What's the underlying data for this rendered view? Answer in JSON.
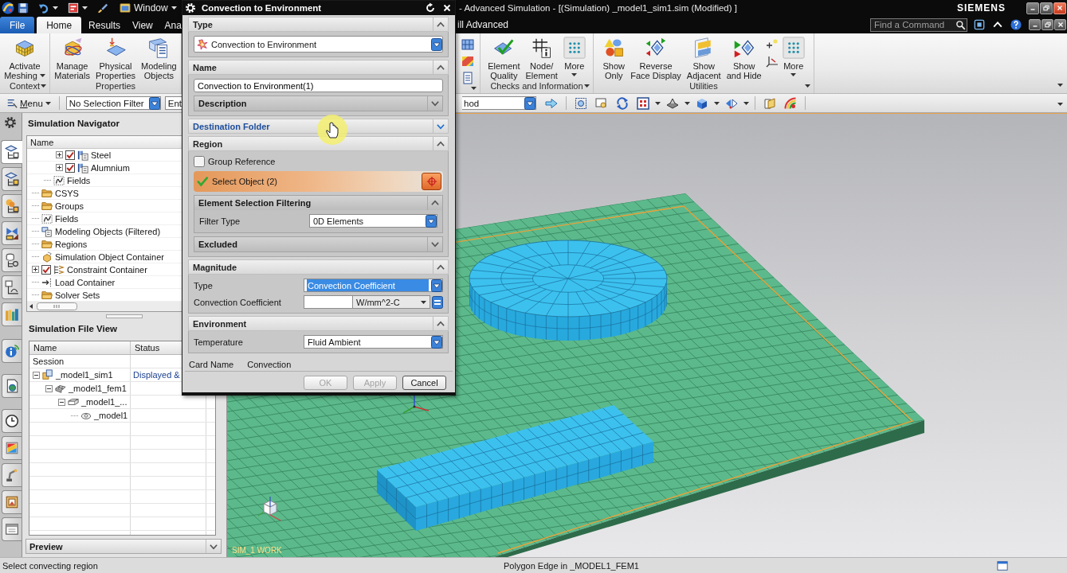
{
  "title_bar": {
    "menu": "Window",
    "title": "- Advanced Simulation - [(Simulation) _model1_sim1.sim (Modified) ]",
    "brand": "SIEMENS"
  },
  "tab_bar": {
    "tabs": [
      {
        "label": "File",
        "kind": "file",
        "selected": false
      },
      {
        "label": "Home",
        "kind": "tab",
        "selected": true
      },
      {
        "label": "Results",
        "kind": "tab",
        "selected": false
      },
      {
        "label": "View",
        "kind": "tab",
        "selected": false
      },
      {
        "label": "Ana",
        "kind": "tab",
        "selected": false
      }
    ],
    "application": "ill Advanced",
    "command_finder": {
      "placeholder": "Find a Command"
    }
  },
  "ribbon_groups": [
    {
      "label": "Context",
      "launcher": true,
      "commands": [
        {
          "kind": "large",
          "lines": [
            "Activate",
            "Meshing"
          ],
          "dropdown": true
        }
      ]
    },
    {
      "label": "Properties",
      "launcher": false,
      "commands": [
        {
          "kind": "large",
          "lines": [
            "Manage",
            "Materials"
          ],
          "dropdown": false
        },
        {
          "kind": "large",
          "lines": [
            "Physical",
            "Properties"
          ],
          "dropdown": false
        },
        {
          "kind": "large",
          "lines": [
            "Modeling",
            "Objects"
          ],
          "dropdown": false
        }
      ]
    },
    {
      "launcher": true,
      "commands": [
        {
          "kind": "small"
        },
        {
          "kind": "small"
        },
        {
          "kind": "small"
        }
      ]
    },
    {
      "label": "Checks and Information",
      "launcher": true,
      "commands": [
        {
          "kind": "large",
          "lines": [
            "Element",
            "Quality"
          ],
          "dropdown": false
        },
        {
          "kind": "large",
          "lines": [
            "Node/",
            "Element"
          ],
          "dropdown": false
        },
        {
          "kind": "large",
          "lines": [
            "More"
          ],
          "dropdown": true
        }
      ]
    },
    {
      "label": "Utilities",
      "launcher": true,
      "commands": [
        {
          "kind": "large",
          "lines": [
            "Show",
            "Only"
          ],
          "dropdown": false
        },
        {
          "kind": "large",
          "lines": [
            "Reverse",
            "Face Display"
          ],
          "dropdown": false
        },
        {
          "kind": "large",
          "lines": [
            "Show",
            "Adjacent"
          ],
          "dropdown": false
        },
        {
          "kind": "large",
          "lines": [
            "Show",
            "and Hide"
          ],
          "dropdown": false
        },
        {
          "kind": "small"
        },
        {
          "kind": "small"
        },
        {
          "kind": "large",
          "lines": [
            "More"
          ],
          "dropdown": true
        }
      ]
    }
  ],
  "toolbar": {
    "menu": "Menu",
    "dropdowns": [
      {
        "value": "No Selection Filter"
      },
      {
        "value": "Ent"
      },
      {
        "value": "hod"
      }
    ]
  },
  "resource_bar": {
    "tabs": [
      {
        "selected": true
      },
      {
        "selected": false
      },
      {
        "selected": false
      },
      {
        "selected": false
      },
      {
        "selected": false
      },
      {
        "selected": false
      },
      {
        "selected": false
      },
      {
        "selected": false
      },
      {
        "selected": false
      },
      {
        "selected": false
      },
      {
        "selected": false
      },
      {
        "selected": false
      },
      {
        "selected": false
      },
      {
        "selected": false
      }
    ]
  },
  "navigator": {
    "title": "Simulation Navigator",
    "column": "Name",
    "tree": [
      {
        "children": [
          {
            "children": [
              {
                "label": "Steel",
                "kind": "material",
                "checked": true,
                "expanded": false
              },
              {
                "label": "Alumnium",
                "kind": "material",
                "checked": true,
                "expanded": false
              }
            ]
          },
          {
            "label": "Fields",
            "kind": "fields"
          }
        ]
      },
      {
        "label": "CSYS",
        "kind": "folder"
      },
      {
        "label": "Groups",
        "kind": "folder"
      },
      {
        "label": "Fields",
        "kind": "fields"
      },
      {
        "label": "Modeling Objects (Filtered)",
        "kind": "modeling"
      },
      {
        "label": "Regions",
        "kind": "folder"
      },
      {
        "label": "Simulation Object Container",
        "kind": "container"
      },
      {
        "label": "Constraint Container",
        "kind": "constraint",
        "checked": true,
        "expanded": false
      },
      {
        "label": "Load Container",
        "kind": "load"
      },
      {
        "label": "Solver Sets",
        "kind": "folder"
      }
    ]
  },
  "file_view": {
    "title": "Simulation File View",
    "columns": [
      "Name",
      "Status"
    ],
    "tree": [
      {
        "label": "Session",
        "kind": "session"
      },
      {
        "label": "_model1_sim1",
        "kind": "simulation",
        "expanded": true,
        "status": "Displayed &",
        "children": [
          {
            "label": "_model1_fem1",
            "kind": "fem",
            "expanded": true,
            "children": [
              {
                "label": "_model1_...",
                "kind": "idealized",
                "expanded": true,
                "children": [
                  {
                    "label": "_model1",
                    "kind": "part"
                  }
                ]
              }
            ]
          }
        ]
      }
    ]
  },
  "preview": {
    "title": "Preview",
    "expanded": false
  },
  "viewport": {
    "label": "SIM_1 WORK"
  },
  "dialog": {
    "title": "Convection to Environment",
    "sections": [
      {
        "title": "Type",
        "expanded": true,
        "hover": false,
        "dropdown": "Convection to Environment"
      },
      {
        "title": "Name",
        "expanded": true,
        "hover": false,
        "input": "Convection to Environment(1)",
        "subsections": [
          {
            "title": "Description",
            "expanded": false
          }
        ]
      },
      {
        "title": "Destination Folder",
        "expanded": false,
        "hover": true
      },
      {
        "title": "Region",
        "expanded": true,
        "hover": false,
        "checkbox": {
          "label": "Group Reference",
          "checked": false
        },
        "selection": {
          "label": "Select Object (2)",
          "complete": true,
          "active": true
        },
        "subsections": [
          {
            "title": "Element Selection Filtering",
            "expanded": true,
            "fields": [
              {
                "kind": "dropdown",
                "label": "Filter Type",
                "value": "0D Elements",
                "focused": false
              }
            ]
          },
          {
            "title": "Excluded",
            "expanded": false
          }
        ]
      },
      {
        "title": "Magnitude",
        "expanded": true,
        "hover": false,
        "fields": [
          {
            "kind": "dropdown",
            "label": "Type",
            "value": "Convection Coefficient",
            "focused": true
          },
          {
            "kind": "expression",
            "label": "Convection Coefficient",
            "unit": "W/mm^2-C"
          }
        ]
      },
      {
        "title": "Environment",
        "expanded": true,
        "hover": false,
        "fields": [
          {
            "kind": "dropdown",
            "label": "Temperature",
            "value": "Fluid Ambient",
            "focused": false
          }
        ]
      }
    ],
    "card": {
      "label": "Card Name",
      "value": "Convection"
    },
    "buttons": [
      {
        "label": "OK",
        "disabled": true
      },
      {
        "label": "Apply",
        "disabled": true
      },
      {
        "label": "Cancel",
        "disabled": false
      }
    ]
  },
  "status_bar": {
    "prompt": "Select convecting region",
    "info": "Polygon Edge in _MODEL1_FEM1"
  }
}
